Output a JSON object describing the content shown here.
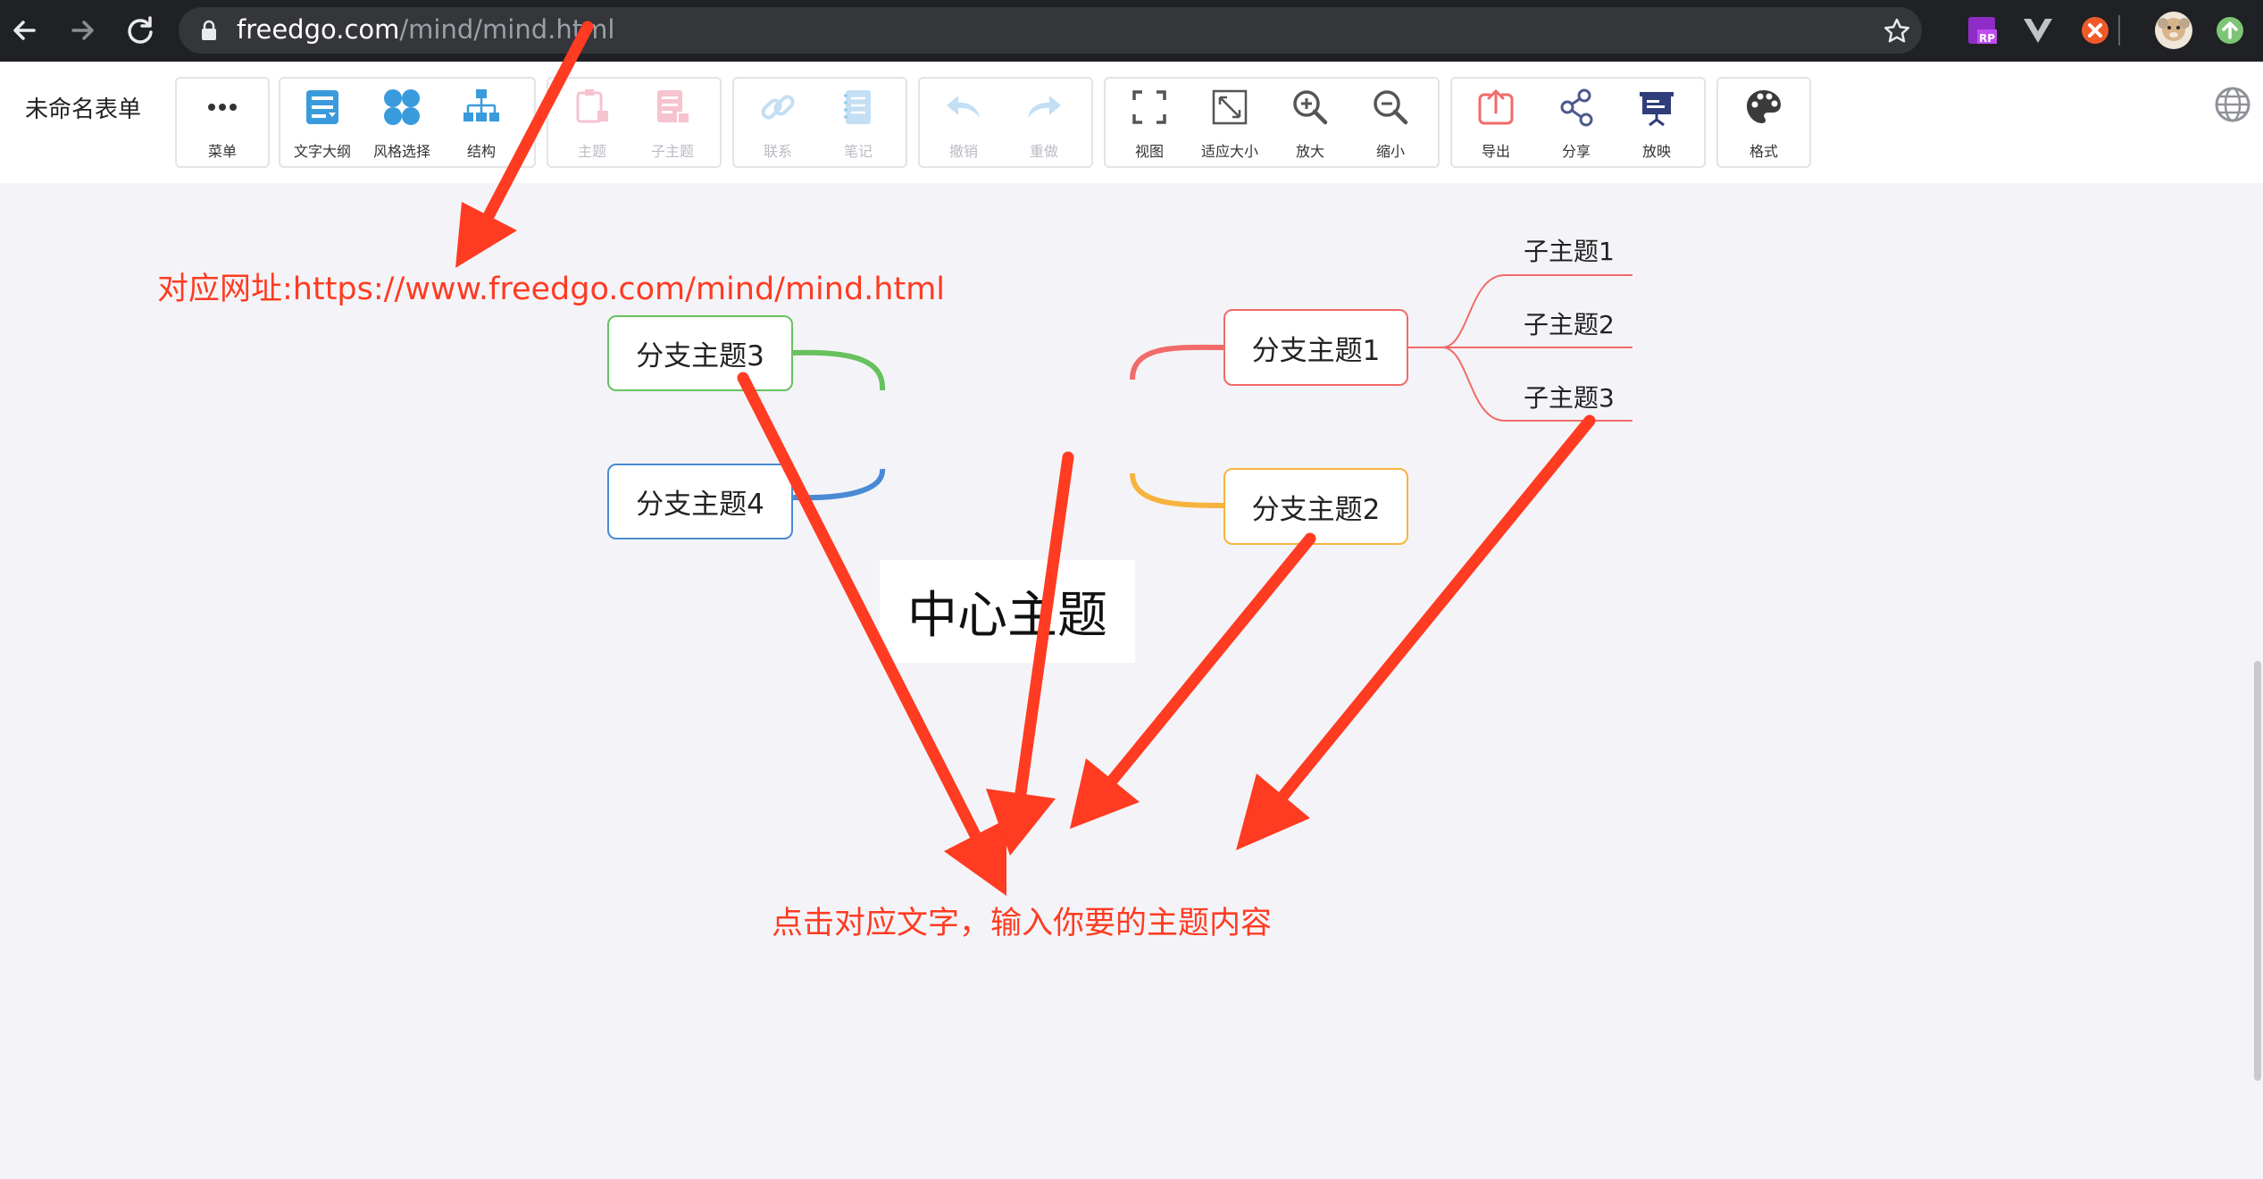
{
  "browser": {
    "url_host": "freedgo.com",
    "url_path": "/mind/mind.html",
    "extensions": [
      "rp-extension-icon",
      "vue-devtools-icon",
      "orange-extension-icon",
      "profile-avatar",
      "update-icon"
    ]
  },
  "app": {
    "doc_title": "未命名表单",
    "toolbar": {
      "menu": "菜单",
      "outline": "文字大纲",
      "style": "风格选择",
      "structure": "结构",
      "topic": "主题",
      "subtopic": "子主题",
      "link": "联系",
      "note": "笔记",
      "undo": "撤销",
      "redo": "重做",
      "view": "视图",
      "fit": "适应大小",
      "zoom_in": "放大",
      "zoom_out": "缩小",
      "export": "导出",
      "share": "分享",
      "present": "放映",
      "format": "格式"
    }
  },
  "mindmap": {
    "center": "中心主题",
    "branch1": "分支主题1",
    "branch2": "分支主题2",
    "branch3": "分支主题3",
    "branch4": "分支主题4",
    "sub1": "子主题1",
    "sub2": "子主题2",
    "sub3": "子主题3",
    "colors": {
      "branch1": "#f26a6a",
      "branch2": "#f7b33e",
      "branch3": "#67c15e",
      "branch4": "#4a8ad4",
      "accent": "#3a9bdc",
      "annotation": "#ff3b22"
    }
  },
  "annotations": {
    "url_note": "对应网址:https://www.freedgo.com/mind/mind.html",
    "click_note": "点击对应文字，输入你要的主题内容"
  }
}
